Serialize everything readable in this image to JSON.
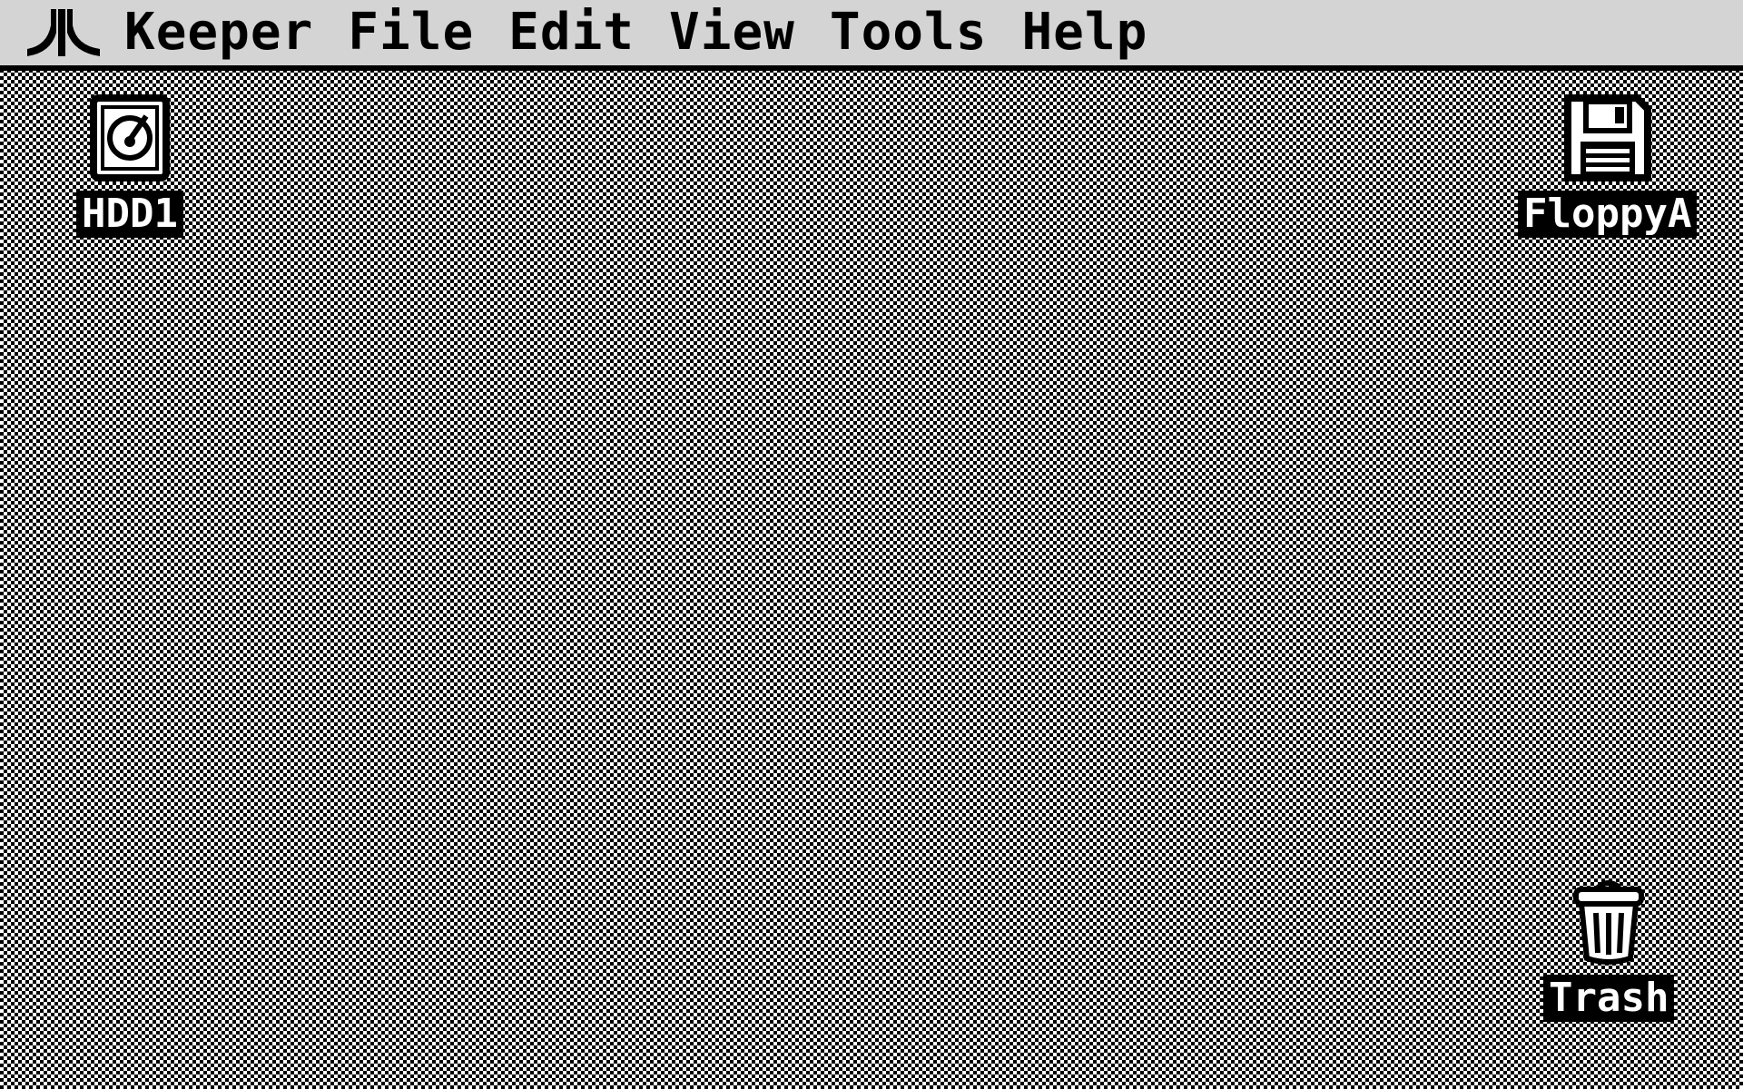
{
  "menubar": {
    "logo_icon": "atari-fuji-icon",
    "items": [
      "Keeper",
      "File",
      "Edit",
      "View",
      "Tools",
      "Help"
    ]
  },
  "desktop": {
    "pattern": "checkerboard-dither",
    "icons": [
      {
        "icon": "hard-drive-icon",
        "label": "HDD1"
      },
      {
        "icon": "floppy-disk-icon",
        "label": "FloppyA"
      },
      {
        "icon": "trash-can-icon",
        "label": "Trash"
      }
    ]
  },
  "colors": {
    "menubar_bg": "#d4d4d4",
    "ink": "#000000",
    "paper": "#ffffff"
  }
}
